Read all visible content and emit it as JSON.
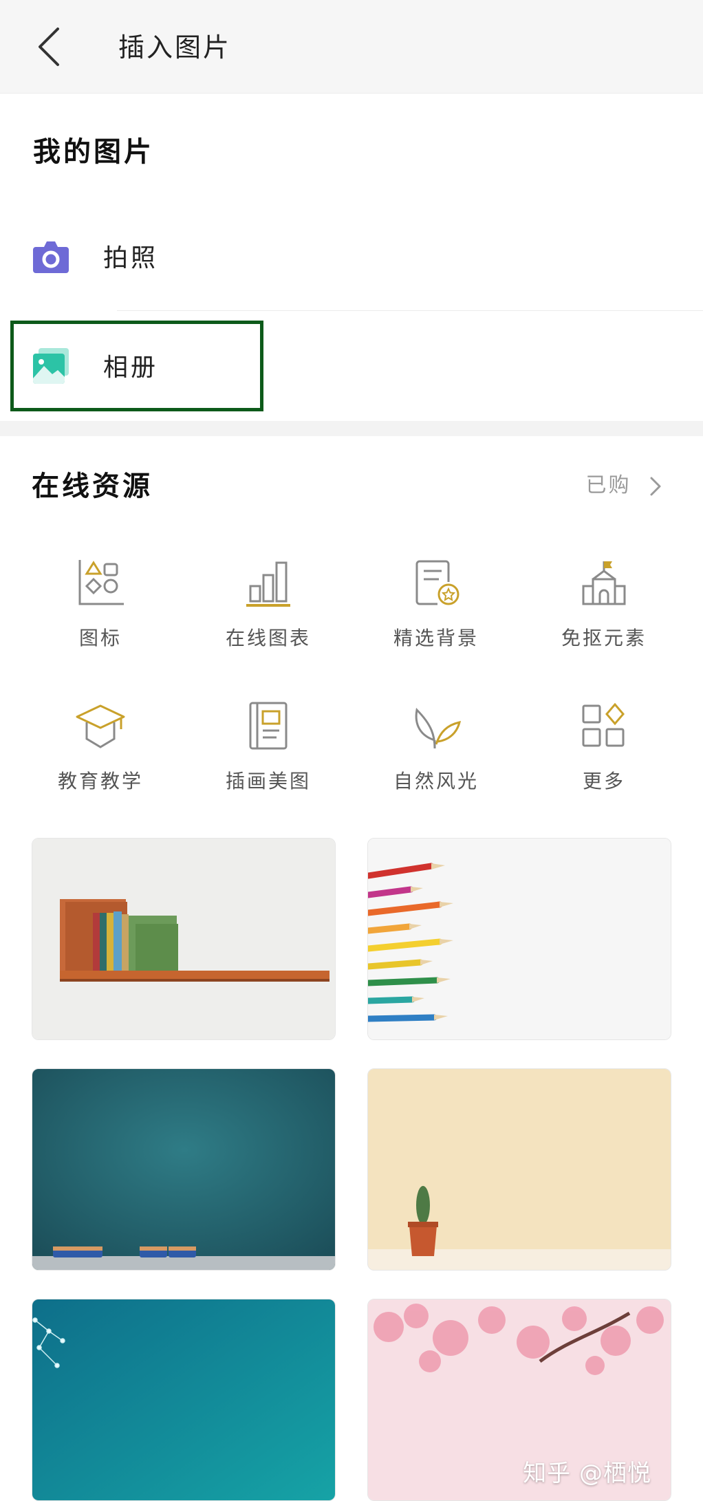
{
  "header": {
    "title": "插入图片"
  },
  "my_pictures": {
    "title": "我的图片",
    "items": [
      {
        "label": "拍照",
        "icon": "camera-icon",
        "color": "#6e6ad6"
      },
      {
        "label": "相册",
        "icon": "album-icon",
        "color": "#2cc3a6"
      }
    ]
  },
  "online": {
    "title": "在线资源",
    "purchased_label": "已购",
    "categories": [
      {
        "label": "图标",
        "icon": "shapes-icon"
      },
      {
        "label": "在线图表",
        "icon": "bar-chart-icon"
      },
      {
        "label": "精选背景",
        "icon": "badge-document-icon"
      },
      {
        "label": "免抠元素",
        "icon": "castle-icon"
      },
      {
        "label": "教育教学",
        "icon": "graduation-cap-icon"
      },
      {
        "label": "插画美图",
        "icon": "book-icon"
      },
      {
        "label": "自然风光",
        "icon": "leaf-icon"
      },
      {
        "label": "更多",
        "icon": "more-grid-icon"
      }
    ],
    "thumbnails": [
      {
        "name": "bookshelf-thumbnail"
      },
      {
        "name": "colored-pencils-thumbnail"
      },
      {
        "name": "chalkboard-thumbnail"
      },
      {
        "name": "cactus-thumbnail"
      },
      {
        "name": "teal-network-thumbnail"
      },
      {
        "name": "cherry-blossom-thumbnail"
      }
    ]
  },
  "colors": {
    "accent_gold": "#c9a12b",
    "icon_gray": "#8a8a8a",
    "highlight": "#0d5a1a"
  },
  "watermark": "知乎 @栖悦"
}
